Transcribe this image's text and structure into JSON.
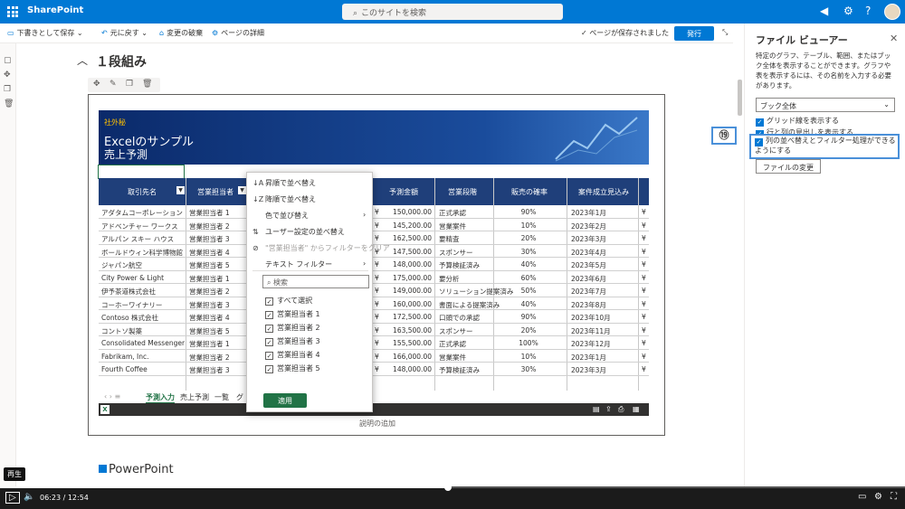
{
  "suite": {
    "brand": "SharePoint",
    "search_placeholder": "このサイトを検索"
  },
  "commandbar": {
    "save_draft": "下書きとして保存",
    "undo": "元に戻す",
    "discard": "変更の破棄",
    "page_details": "ページの詳細",
    "saved_status": "ページが保存されました",
    "publish": "発行"
  },
  "section": {
    "title": "１段組み"
  },
  "excel": {
    "confidential": "社外秘",
    "title": "Excelのサンプル",
    "subtitle": "売上予測",
    "headers": [
      "取引先名",
      "営業担当者",
      "予測金額",
      "営業段階",
      "販売の確率",
      "案件成立見込み"
    ],
    "rows": [
      [
        "アダタムコーポレーション",
        "営業担当者 1",
        "¥",
        "150,000.00",
        "正式承認",
        "90%",
        "2023年1月",
        "¥"
      ],
      [
        "アドベンチャー ワークス",
        "営業担当者 2",
        "¥",
        "145,200.00",
        "営業案件",
        "10%",
        "2023年2月",
        "¥"
      ],
      [
        "アルパン スキー ハウス",
        "営業担当者 3",
        "¥",
        "162,500.00",
        "要精査",
        "20%",
        "2023年3月",
        "¥"
      ],
      [
        "ボールドウィン科学博物館",
        "営業担当者 4",
        "¥",
        "147,500.00",
        "スポンサー",
        "30%",
        "2023年4月",
        "¥"
      ],
      [
        "ジャパン航空",
        "営業担当者 5",
        "¥",
        "148,000.00",
        "予算検証済み",
        "40%",
        "2023年5月",
        "¥"
      ],
      [
        "City Power & Light",
        "営業担当者 1",
        "¥",
        "175,000.00",
        "要分析",
        "60%",
        "2023年6月",
        "¥"
      ],
      [
        "伊予茶道株式会社",
        "営業担当者 2",
        "¥",
        "149,000.00",
        "ソリューション提案済み",
        "50%",
        "2023年7月",
        "¥"
      ],
      [
        "コーホーワイナリー",
        "営業担当者 3",
        "¥",
        "160,000.00",
        "書面による提案済み",
        "40%",
        "2023年8月",
        "¥"
      ],
      [
        "Contoso 株式会社",
        "営業担当者 4",
        "¥",
        "172,500.00",
        "口頭での承認",
        "90%",
        "2023年10月",
        "¥"
      ],
      [
        "コントソ製薬",
        "営業担当者 5",
        "¥",
        "163,500.00",
        "スポンサー",
        "20%",
        "2023年11月",
        "¥"
      ],
      [
        "Consolidated Messenger",
        "営業担当者 1",
        "¥",
        "155,500.00",
        "正式承認",
        "100%",
        "2023年12月",
        "¥"
      ],
      [
        "Fabrikam, Inc.",
        "営業担当者 2",
        "¥",
        "166,000.00",
        "営業案件",
        "10%",
        "2023年1月",
        "¥"
      ],
      [
        "Fourth Coffee",
        "営業担当者 3",
        "¥",
        "148,000.00",
        "予算検証済み",
        "30%",
        "2023年3月",
        "¥"
      ]
    ],
    "sheet_tabs": [
      "予測入力",
      "売上予測",
      "一覧",
      "グ"
    ],
    "caption": "説明の追加"
  },
  "filter_menu": {
    "sort_asc": "昇順で並べ替え",
    "sort_desc": "降順で並べ替え",
    "sort_color": "色で並び替え",
    "custom_sort": "ユーザー設定の並べ替え",
    "clear_filter": "\"営業担当者\" からフィルターをクリア",
    "text_filter": "テキスト フィルター",
    "search": "検索",
    "select_all": "すべて選択",
    "items": [
      "営業担当者 1",
      "営業担当者 2",
      "営業担当者 3",
      "営業担当者 4",
      "営業担当者 5"
    ],
    "apply": "適用"
  },
  "ppt_heading": "PowerPoint",
  "panel": {
    "title": "ファイル ビューアー",
    "desc": "特定のグラフ、テーブル、範囲、またはブック全体を表示することができます。グラフや表を表示するには、その名前を入力する必要があります。",
    "select": "ブック全体",
    "opt_gridlines": "グリッド線を表示する",
    "opt_headings": "行と列の見出しを表示する",
    "opt_sortfilter": "列の並べ替えとフィルター処理ができるようにする",
    "change_file": "ファイルの変更",
    "callout": "⑲"
  },
  "video": {
    "tooltip": "再生",
    "time": "06:23 / 12:54",
    "progress": 0.495
  }
}
